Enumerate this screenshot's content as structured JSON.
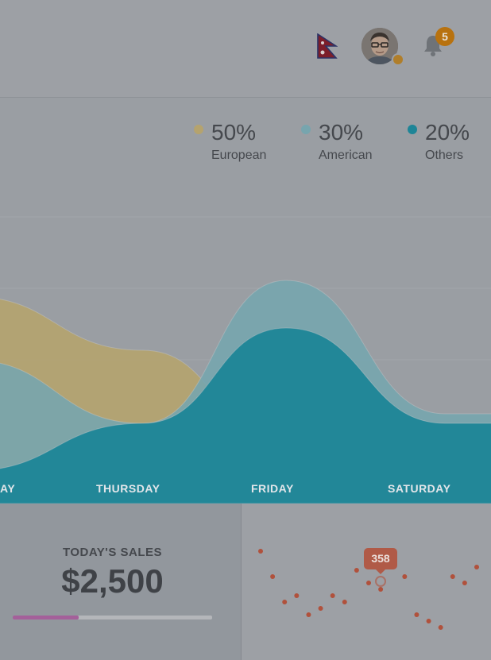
{
  "header": {
    "notification_count": "5"
  },
  "legend": [
    {
      "percent": "50%",
      "label": "European",
      "color": "#b5a36e"
    },
    {
      "percent": "30%",
      "label": "American",
      "color": "#77a5ae"
    },
    {
      "percent": "20%",
      "label": "Others",
      "color": "#1e8597"
    }
  ],
  "chart_data": {
    "type": "area",
    "x": [
      "WEDNESDAY",
      "THURSDAY",
      "FRIDAY",
      "SATURDAY"
    ],
    "x_visible_labels": [
      "AY",
      "THURSDAY",
      "FRIDAY",
      "SATURDAY"
    ],
    "series": [
      {
        "name": "European",
        "values": [
          55,
          38,
          10,
          0
        ]
      },
      {
        "name": "American",
        "values": [
          35,
          15,
          60,
          18
        ]
      },
      {
        "name": "Others",
        "values": [
          0,
          15,
          45,
          15
        ]
      }
    ],
    "grid": true
  },
  "sales": {
    "title": "TODAY'S SALES",
    "value": "$2,500",
    "progress": 0.33
  },
  "scatter": {
    "tooltip": "358",
    "type": "scatter",
    "values": [
      30,
      22,
      14,
      16,
      10,
      12,
      16,
      14,
      24,
      20,
      18,
      28,
      22,
      10,
      8,
      6,
      22,
      20,
      25
    ]
  },
  "colors": {
    "progress": "#a4609a",
    "points": "#b0513c",
    "tooltip": "#b05a47"
  }
}
